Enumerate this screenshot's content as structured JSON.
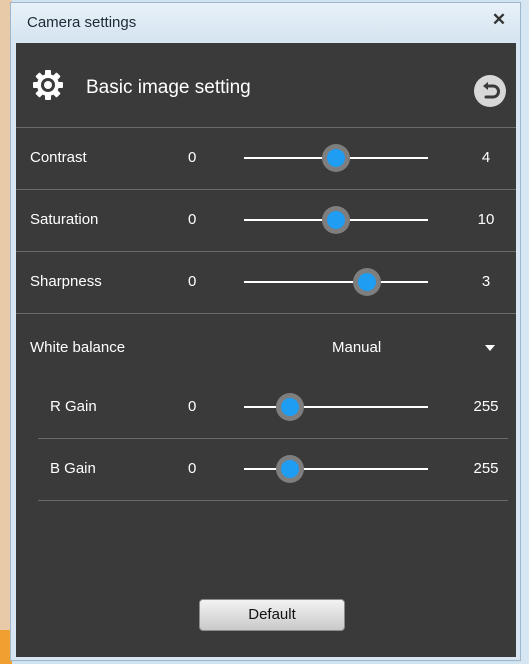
{
  "window": {
    "title": "Camera settings",
    "close_label": "✕"
  },
  "header": {
    "title": "Basic image setting",
    "settings_icon": "gear-icon",
    "back_icon": "undo-icon"
  },
  "sliders": [
    {
      "label": "Contrast",
      "min": "0",
      "max": "4",
      "value": 2,
      "range": [
        0,
        4
      ]
    },
    {
      "label": "Saturation",
      "min": "0",
      "max": "10",
      "value": 5,
      "range": [
        0,
        10
      ]
    },
    {
      "label": "Sharpness",
      "min": "0",
      "max": "3",
      "value": 2,
      "range": [
        0,
        3
      ]
    }
  ],
  "white_balance": {
    "label": "White balance",
    "value": "Manual"
  },
  "gains": [
    {
      "label": "R Gain",
      "min": "0",
      "max": "255",
      "value": 64,
      "range": [
        0,
        255
      ]
    },
    {
      "label": "B Gain",
      "min": "0",
      "max": "255",
      "value": 64,
      "range": [
        0,
        255
      ]
    }
  ],
  "footer": {
    "default_label": "Default"
  },
  "colors": {
    "thumb_accent": "#1e9df2",
    "panel_bg": "#3a3a3a"
  }
}
